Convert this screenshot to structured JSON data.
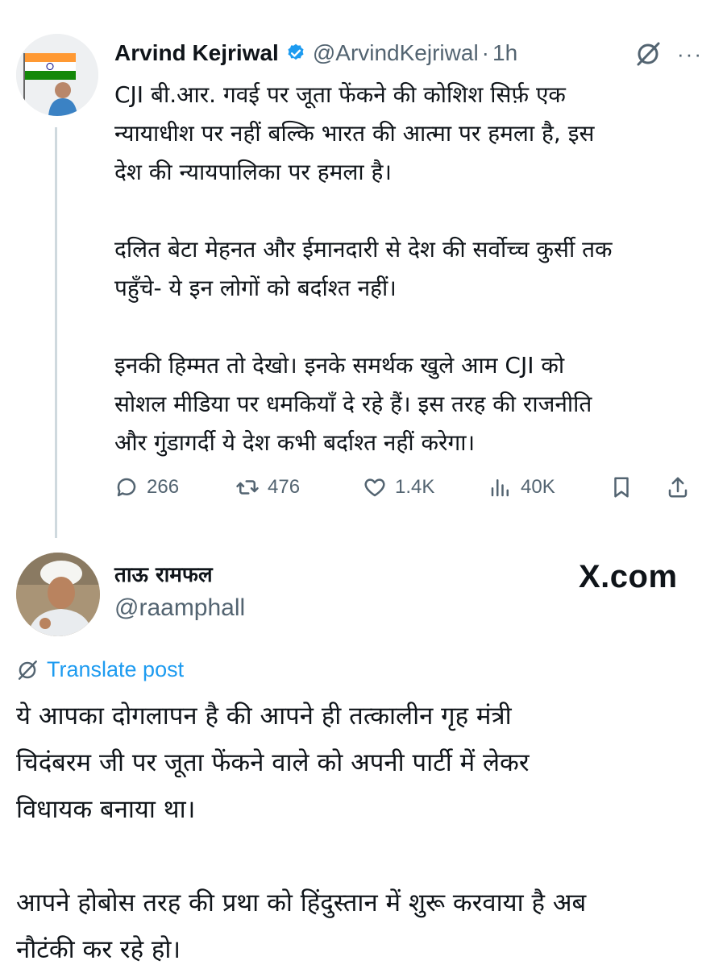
{
  "tweet": {
    "author_name": "Arvind Kejriwal",
    "author_handle": "@ArvindKejriwal",
    "separator": "·",
    "time": "1h",
    "more_label": "···",
    "paragraphs": [
      "CJI बी.आर. गवई पर जूता फेंकने की कोशिश सिर्फ़ एक\nन्यायाधीश पर नहीं बल्कि भारत की आत्मा पर हमला है, इस\nदेश की न्यायपालिका पर हमला है।",
      "दलित बेटा मेहनत और ईमानदारी से देश की सर्वोच्च कुर्सी तक\nपहुँचे- ये इन लोगों को बर्दाश्त नहीं।",
      "इनकी हिम्मत तो देखो। इनके समर्थक खुले आम CJI को\nसोशल मीडिया पर धमकियाँ दे रहे हैं। इस तरह की राजनीति\nऔर गुंडागर्दी ये देश कभी बर्दाश्त नहीं करेगा।"
    ],
    "replies": "266",
    "reposts": "476",
    "likes": "1.4K",
    "views": "40K",
    "icons": [
      "verified-badge-icon",
      "grok-icon",
      "more-icon",
      "reply-icon",
      "repost-icon",
      "like-icon",
      "views-icon",
      "bookmark-icon",
      "share-icon"
    ],
    "accent_color": "#1d9bf0"
  },
  "reply": {
    "author_name": "ताऊ रामफल",
    "author_handle": "@raamphall",
    "watermark": "X.com",
    "translate_label": "Translate post",
    "paragraphs": [
      "ये आपका दोगलापन है की आपने ही तत्कालीन गृह मंत्री\nचिदंबरम जी पर जूता फेंकने वाले को अपनी पार्टी में लेकर\nविधायक बनाया था।",
      "आपने होबोस तरह की प्रथा को हिंदुस्तान में शुरू करवाया है अब\nनौटंकी कर रहे हो।"
    ]
  }
}
